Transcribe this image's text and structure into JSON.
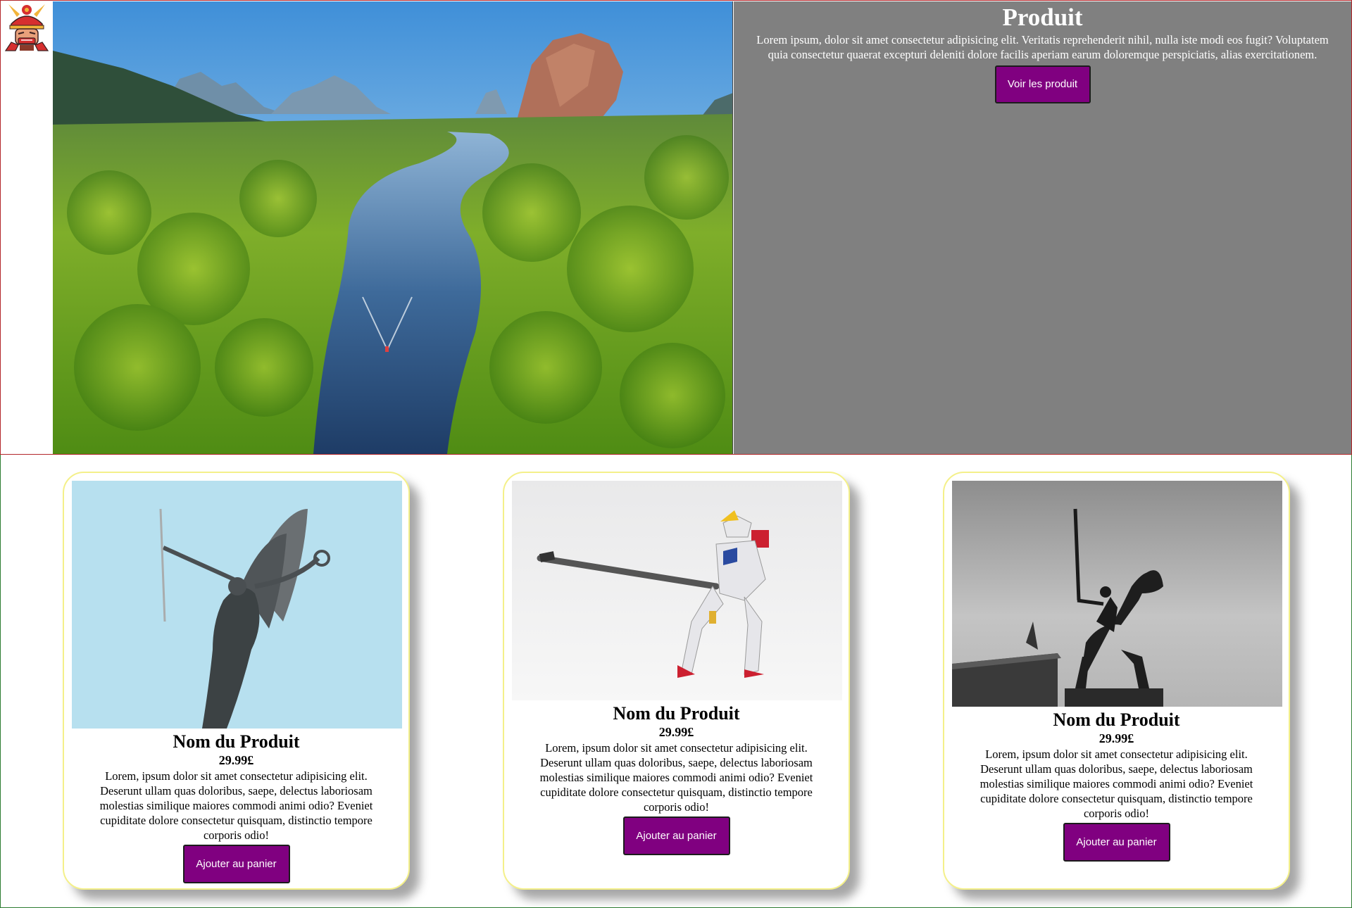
{
  "hero": {
    "logo_icon": "samurai-mask-icon",
    "image": "river-through-mangrove-forest-photo",
    "title": "Produit",
    "description": "Lorem ipsum, dolor sit amet consectetur adipisicing elit. Veritatis reprehenderit nihil, nulla iste modi eos fugit? Voluptatem quia consectetur quaerat excepturi deleniti dolore facilis aperiam earum doloremque perspiciatis, alias exercitationem.",
    "button_label": "Voir les produit"
  },
  "products": [
    {
      "image": "winged-angel-statue-photo",
      "name": "Nom du Produit",
      "price": "29.99£",
      "description": "Lorem, ipsum dolor sit amet consectetur adipisicing elit. Deserunt ullam quas doloribus, saepe, delectus laboriosam molestias similique maiores commodi animi odio? Eveniet cupiditate dolore consectetur quisquam, distinctio tempore corporis odio!",
      "button_label": "Ajouter au panier"
    },
    {
      "image": "robot-figure-with-sword-photo",
      "name": "Nom du Produit",
      "price": "29.99£",
      "description": "Lorem, ipsum dolor sit amet consectetur adipisicing elit. Deserunt ullam quas doloribus, saepe, delectus laboriosam molestias similique maiores commodi animi odio? Eveniet cupiditate dolore consectetur quisquam, distinctio tempore corporis odio!",
      "button_label": "Ajouter au panier"
    },
    {
      "image": "equestrian-statue-photo",
      "name": "Nom du Produit",
      "price": "29.99£",
      "description": "Lorem, ipsum dolor sit amet consectetur adipisicing elit. Deserunt ullam quas doloribus, saepe, delectus laboriosam molestias similique maiores commodi animi odio? Eveniet cupiditate dolore consectetur quisquam, distinctio tempore corporis odio!",
      "button_label": "Ajouter au panier"
    }
  ],
  "colors": {
    "button_bg": "#800080",
    "hero_panel_bg": "#808080",
    "card_border": "#f4f08a",
    "hero_border": "#b3262a",
    "section_border": "#2e7d32"
  }
}
